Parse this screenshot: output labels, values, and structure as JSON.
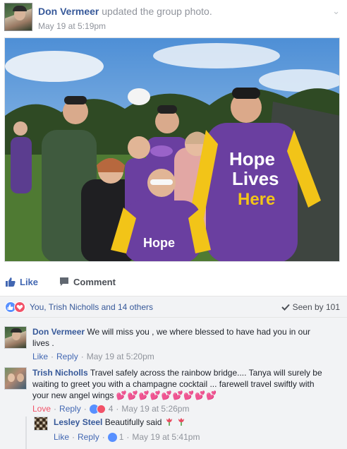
{
  "post": {
    "author": "Don Vermeer",
    "action": "updated the group photo.",
    "time": "May 19 at 5:19pm"
  },
  "photo": {
    "shirt_text": [
      "Hope",
      "Lives",
      "Here"
    ],
    "small_shirt_text": "Hope"
  },
  "actions": {
    "like_label": "Like",
    "comment_label": "Comment"
  },
  "reactions": {
    "names": "You, Trish Nicholls and 14 others",
    "seen": "Seen by 101"
  },
  "comments": [
    {
      "author": "Don Vermeer",
      "text": "We will miss you , we where blessed to have had you in our lives .",
      "like": "Like",
      "reply": "Reply",
      "time": "May 19 at 5:20pm"
    },
    {
      "author": "Trish Nicholls",
      "text": "Travel safely across the rainbow bridge.... Tanya will surely be waiting to greet you with a champagne cocktail ... farewell travel swiftly with your new angel wings",
      "hearts": "💕💕💕💕💕💕💕💕💕",
      "love": "Love",
      "reply": "Reply",
      "reaction_count": "4",
      "time": "May 19 at 5:26pm"
    }
  ],
  "reply": {
    "author": "Lesley Steel",
    "text": "Beautifully said",
    "like": "Like",
    "reply": "Reply",
    "reaction_count": "1",
    "time": "May 19 at 5:41pm"
  },
  "colors": {
    "link_blue": "#365899",
    "action_blue": "#4267b2",
    "meta_gray": "#90949c",
    "love_red": "#f25268",
    "comment_bg": "#f2f3f5",
    "shirt_purple": "#6a3fa0",
    "shirt_yellow": "#f2c418"
  }
}
